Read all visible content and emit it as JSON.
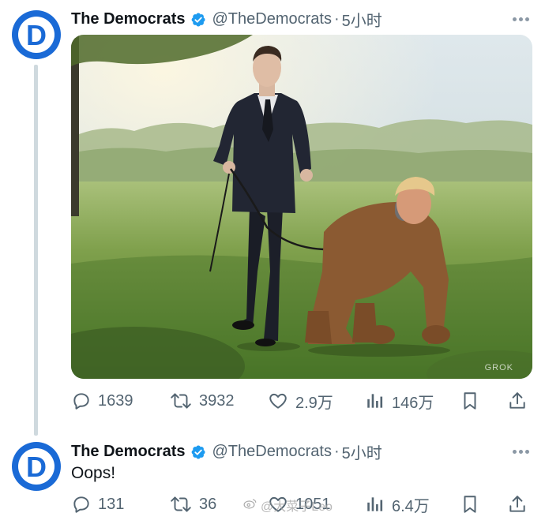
{
  "tweets": [
    {
      "author": "The Democrats",
      "handle": "@TheDemocrats",
      "separator": "·",
      "time": "5小时",
      "avatar_letter": "D",
      "media": {
        "watermark": "GROK"
      },
      "actions": {
        "replies": "1639",
        "retweets": "3932",
        "likes": "2.9万",
        "views": "146万"
      }
    },
    {
      "author": "The Democrats",
      "handle": "@TheDemocrats",
      "separator": "·",
      "time": "5小时",
      "avatar_letter": "D",
      "text": "Oops!",
      "actions": {
        "replies": "131",
        "retweets": "36",
        "likes": "1051",
        "views": "6.4万"
      }
    }
  ],
  "page_watermark": "@大菜子Leo",
  "colors": {
    "brand_blue": "#1a6ad6",
    "verified_blue": "#1d9bf0",
    "muted_text": "#536471",
    "thread_line": "#cfd9de"
  },
  "icons": [
    "reply-icon",
    "retweet-icon",
    "like-icon",
    "views-icon",
    "bookmark-icon",
    "share-icon",
    "verified-badge-icon",
    "more-icon"
  ]
}
